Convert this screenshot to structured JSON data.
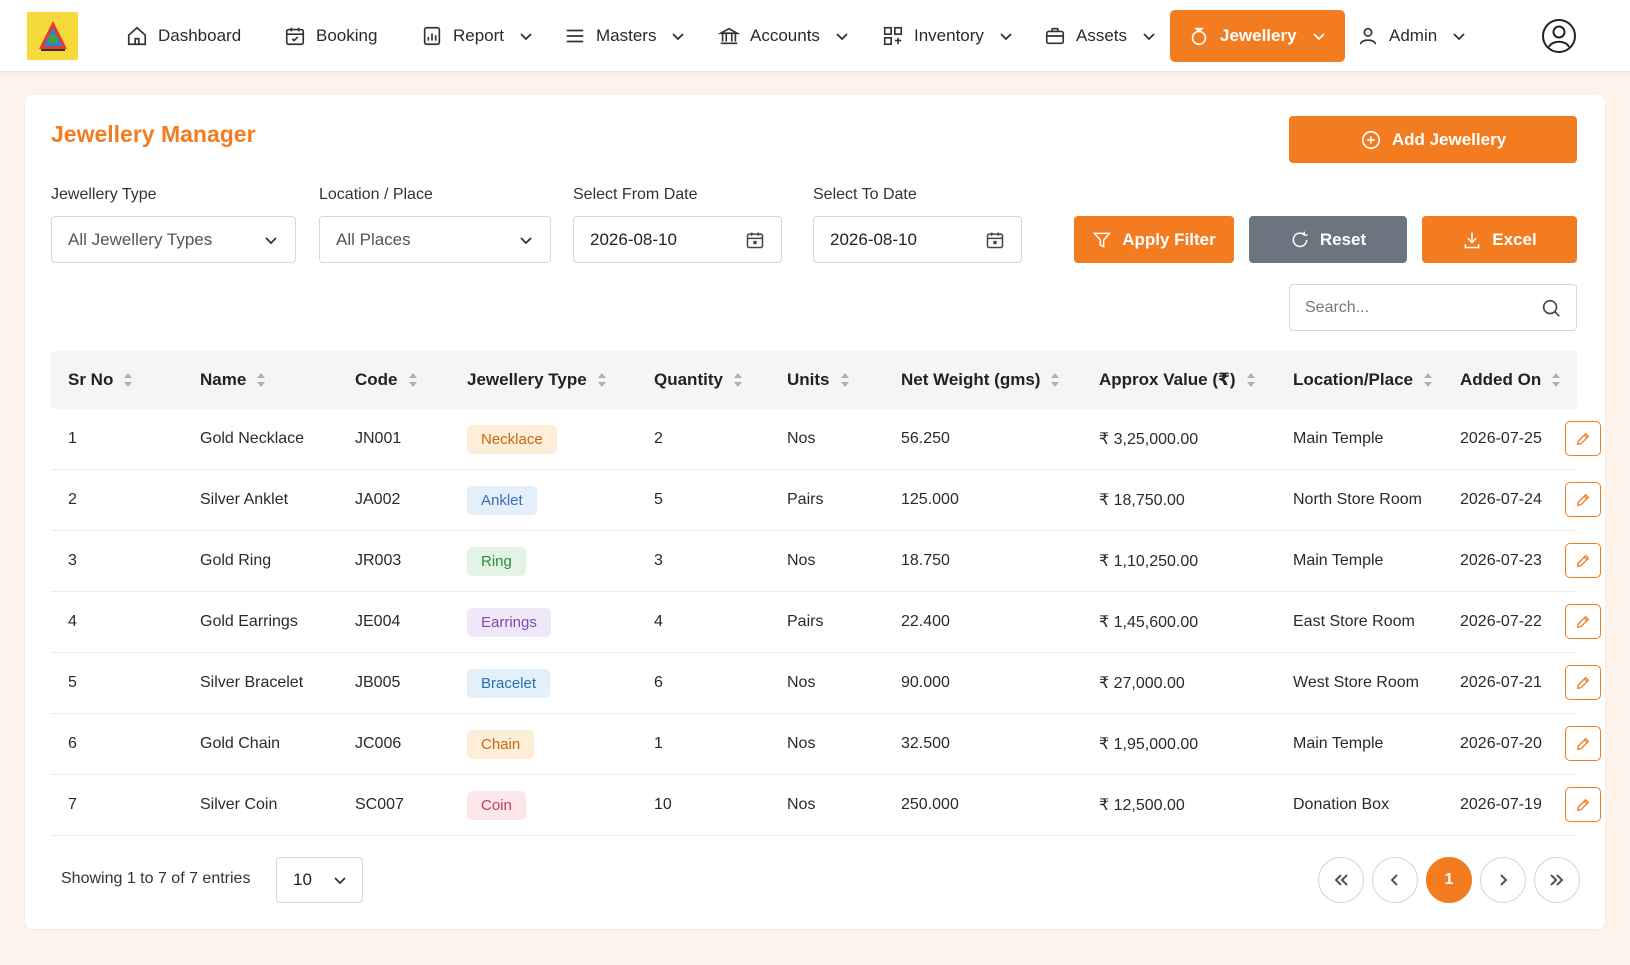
{
  "colors": {
    "accent": "#f47c20",
    "reset": "#6c7480"
  },
  "nav": {
    "items": [
      {
        "label": "Dashboard",
        "icon": "home-icon"
      },
      {
        "label": "Booking",
        "icon": "calendar-icon"
      },
      {
        "label": "Report",
        "icon": "report-icon"
      },
      {
        "label": "Masters",
        "icon": "menu-icon"
      },
      {
        "label": "Accounts",
        "icon": "bank-icon"
      },
      {
        "label": "Inventory",
        "icon": "grid-icon"
      },
      {
        "label": "Assets",
        "icon": "briefcase-icon"
      },
      {
        "label": "Jewellery",
        "icon": "ring-icon"
      },
      {
        "label": "Admin",
        "icon": "user-icon"
      }
    ]
  },
  "page": {
    "title": "Jewellery Manager",
    "add_label": "Add Jewellery"
  },
  "filters": {
    "type_label": "Jewellery Type",
    "type_value": "All Jewellery Types",
    "location_label": "Location / Place",
    "location_value": "All Places",
    "from_label": "Select From Date",
    "from_value": "2026-08-10",
    "to_label": "Select To Date",
    "to_value": "2026-08-10",
    "apply_label": "Apply Filter",
    "reset_label": "Reset",
    "excel_label": "Excel"
  },
  "search": {
    "placeholder": "Search..."
  },
  "table": {
    "headers": [
      "Sr No",
      "Name",
      "Code",
      "Jewellery Type",
      "Quantity",
      "Units",
      "Net Weight (gms)",
      "Approx Value (₹)",
      "Location/Place",
      "Added On"
    ],
    "rows": [
      {
        "sr": "1",
        "name": "Gold Necklace",
        "code": "JN001",
        "type": "Necklace",
        "qty": "2",
        "units": "Nos",
        "weight": "56.250",
        "value": "₹ 3,25,000.00",
        "location": "Main Temple",
        "added": "2026-07-25"
      },
      {
        "sr": "2",
        "name": "Silver Anklet",
        "code": "JA002",
        "type": "Anklet",
        "qty": "5",
        "units": "Pairs",
        "weight": "125.000",
        "value": "₹ 18,750.00",
        "location": "North Store Room",
        "added": "2026-07-24"
      },
      {
        "sr": "3",
        "name": "Gold Ring",
        "code": "JR003",
        "type": "Ring",
        "qty": "3",
        "units": "Nos",
        "weight": "18.750",
        "value": "₹ 1,10,250.00",
        "location": "Main Temple",
        "added": "2026-07-23"
      },
      {
        "sr": "4",
        "name": "Gold Earrings",
        "code": "JE004",
        "type": "Earrings",
        "qty": "4",
        "units": "Pairs",
        "weight": "22.400",
        "value": "₹ 1,45,600.00",
        "location": "East Store Room",
        "added": "2026-07-22"
      },
      {
        "sr": "5",
        "name": "Silver Bracelet",
        "code": "JB005",
        "type": "Bracelet",
        "qty": "6",
        "units": "Nos",
        "weight": "90.000",
        "value": "₹ 27,000.00",
        "location": "West Store Room",
        "added": "2026-07-21"
      },
      {
        "sr": "6",
        "name": "Gold Chain",
        "code": "JC006",
        "type": "Chain",
        "qty": "1",
        "units": "Nos",
        "weight": "32.500",
        "value": "₹ 1,95,000.00",
        "location": "Main Temple",
        "added": "2026-07-20"
      },
      {
        "sr": "7",
        "name": "Silver Coin",
        "code": "SC007",
        "type": "Coin",
        "qty": "10",
        "units": "Nos",
        "weight": "250.000",
        "value": "₹ 12,500.00",
        "location": "Donation Box",
        "added": "2026-07-19"
      }
    ],
    "badge_colors": {
      "Necklace": {
        "bg": "#fdedd9",
        "fg": "#c46a10"
      },
      "Anklet": {
        "bg": "#e5effb",
        "fg": "#3a6fb8"
      },
      "Ring": {
        "bg": "#e3f4e4",
        "fg": "#2f8a3c"
      },
      "Earrings": {
        "bg": "#f0e8f8",
        "fg": "#7b4bb0"
      },
      "Bracelet": {
        "bg": "#e2f0fa",
        "fg": "#2a6fb0"
      },
      "Chain": {
        "bg": "#fdedd9",
        "fg": "#c46a10"
      },
      "Coin": {
        "bg": "#fce6ea",
        "fg": "#c04060"
      }
    }
  },
  "footer": {
    "showing": "Showing 1 to 7 of 7 entries",
    "per_page": "10",
    "current_page": "1"
  }
}
